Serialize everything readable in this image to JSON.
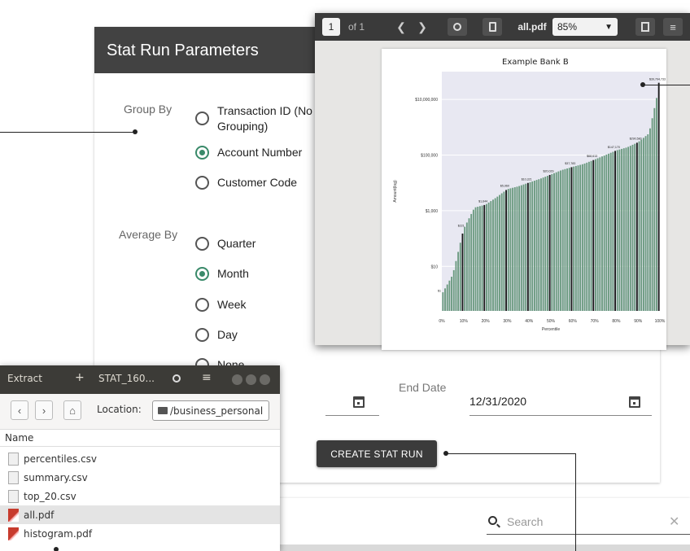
{
  "form": {
    "title": "Stat Run Parameters",
    "group_by": {
      "label": "Group By",
      "options": [
        {
          "label": "Transaction ID (No Grouping)",
          "selected": false
        },
        {
          "label": "Account Number",
          "selected": true
        },
        {
          "label": "Customer Code",
          "selected": false
        }
      ]
    },
    "average_by": {
      "label": "Average By",
      "options": [
        {
          "label": "Quarter",
          "selected": false
        },
        {
          "label": "Month",
          "selected": true
        },
        {
          "label": "Week",
          "selected": false
        },
        {
          "label": "Day",
          "selected": false
        },
        {
          "label": "None",
          "selected": false
        }
      ]
    },
    "end_date": {
      "label": "End Date",
      "value": "12/31/2020"
    },
    "create_button": "CREATE STAT RUN",
    "accent_color": "#3a8a6a"
  },
  "search": {
    "placeholder": "Search",
    "icon": "search-icon",
    "clear_icon": "close-icon"
  },
  "pdf_viewer": {
    "page_input": "1",
    "page_of": "of 1",
    "file_name": "all.pdf",
    "zoom": "85%",
    "prev_icon": "chevron-left-icon",
    "next_icon": "chevron-right-icon"
  },
  "chart_data": {
    "type": "bar",
    "title": "Example Bank B",
    "xlabel": "Percentile",
    "ylabel": "Amount(log)",
    "scale": "log",
    "y_ticks": [
      "$10",
      "$1,000",
      "$100,000",
      "$10,000,000"
    ],
    "x_ticks": [
      "0%",
      "10%",
      "20%",
      "30%",
      "40%",
      "50%",
      "60%",
      "70%",
      "80%",
      "90%",
      "100%"
    ],
    "x": [
      0,
      5,
      10,
      15,
      20,
      25,
      30,
      35,
      40,
      45,
      50,
      55,
      60,
      65,
      70,
      75,
      80,
      85,
      90,
      95,
      100
    ],
    "values": [
      1,
      5,
      221,
      1300,
      1644,
      3000,
      5960,
      7500,
      10321,
      14000,
      20029,
      29000,
      37783,
      48000,
      68613,
      100000,
      147170,
      190000,
      290580,
      600000,
      39794733
    ],
    "data_labels": [
      "$1",
      "$221",
      "$1,644",
      "$5,960",
      "$10,321",
      "$20,029",
      "$37,783",
      "$68,613",
      "$147,170",
      "$290,580",
      "$39,794,733"
    ],
    "background": "#e8e8f2",
    "bar_color": "#6b9a80",
    "grid": true
  },
  "file_manager": {
    "extract_label": "Extract",
    "add_label": "+",
    "title": "STAT_160...",
    "location_label": "Location:",
    "location_value": "/business_personal",
    "column_name": "Name",
    "files": [
      {
        "name": "percentiles.csv",
        "type": "csv",
        "selected": false
      },
      {
        "name": "summary.csv",
        "type": "csv",
        "selected": false
      },
      {
        "name": "top_20.csv",
        "type": "csv",
        "selected": false
      },
      {
        "name": "all.pdf",
        "type": "pdf",
        "selected": true
      },
      {
        "name": "histogram.pdf",
        "type": "pdf",
        "selected": false
      }
    ]
  }
}
